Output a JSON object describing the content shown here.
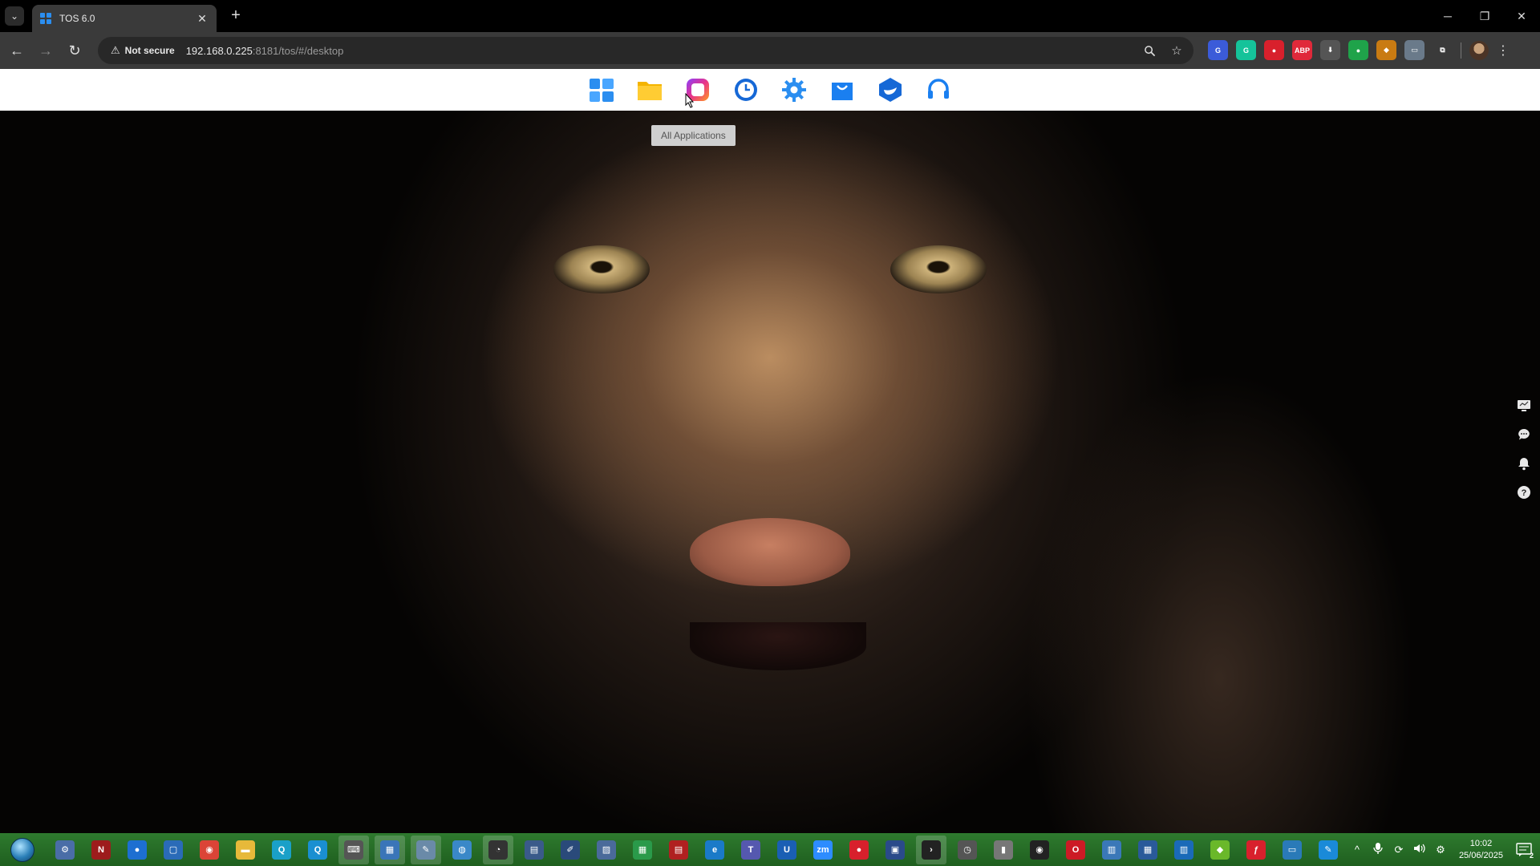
{
  "browser": {
    "tab_title": "TOS 6.0",
    "tab_close_glyph": "✕",
    "new_tab_glyph": "+",
    "window_controls": [
      "─",
      "❐",
      "✕"
    ],
    "nav": {
      "back": "←",
      "forward": "→",
      "reload": "↻"
    },
    "security_label": "Not secure",
    "url_host": "192.168.0.225",
    "url_rest": ":8181/tos/#/desktop",
    "omnibox_icons": [
      "zoom-icon",
      "bookmark-star-icon"
    ],
    "extensions": [
      {
        "name": "translate-extension",
        "color": "#3b5bd9",
        "glyph": "G"
      },
      {
        "name": "grammarly-extension",
        "color": "#15c39a",
        "glyph": "G"
      },
      {
        "name": "red-extension",
        "color": "#d8202c",
        "glyph": "●"
      },
      {
        "name": "adblock-plus-extension",
        "color": "#e0293a",
        "glyph": "ABP"
      },
      {
        "name": "download-extension",
        "color": "#555555",
        "glyph": "⬇"
      },
      {
        "name": "green-extension",
        "color": "#1fa34a",
        "glyph": "●"
      },
      {
        "name": "orange-extension",
        "color": "#c97b12",
        "glyph": "◆"
      },
      {
        "name": "screen-extension",
        "color": "#6a7a8a",
        "glyph": "▭"
      },
      {
        "name": "puzzle-extensions-menu",
        "color": "#3a3a3a",
        "glyph": "⧉"
      }
    ]
  },
  "tos": {
    "dock": [
      {
        "name": "desktop-app-icon",
        "label": "Desktop"
      },
      {
        "name": "file-manager-icon",
        "label": "File Manager"
      },
      {
        "name": "all-applications-icon",
        "label": "All Applications"
      },
      {
        "name": "backup-clock-icon",
        "label": "Backup"
      },
      {
        "name": "control-panel-gear-icon",
        "label": "Control Panel"
      },
      {
        "name": "app-center-bag-icon",
        "label": "App Center"
      },
      {
        "name": "docker-icon",
        "label": "Docker"
      },
      {
        "name": "support-headset-icon",
        "label": "Support"
      }
    ],
    "tooltip": "All Applications",
    "right_rail": [
      "monitor-icon",
      "chat-icon",
      "notification-bell-icon",
      "help-icon"
    ]
  },
  "taskbar": {
    "apps": [
      {
        "name": "settings-gear-app",
        "color": "#4a6da7",
        "glyph": "⚙"
      },
      {
        "name": "red-shield-app",
        "color": "#9d1c1c",
        "glyph": "N"
      },
      {
        "name": "blue-orb-app",
        "color": "#1d6fd1",
        "glyph": "●"
      },
      {
        "name": "window-app",
        "color": "#2a6bb8",
        "glyph": "▢"
      },
      {
        "name": "chrome-app",
        "color": "#db4437",
        "glyph": "◉"
      },
      {
        "name": "file-explorer-app",
        "color": "#e7b93a",
        "glyph": "▬"
      },
      {
        "name": "search-globe-app",
        "color": "#1aa0c8",
        "glyph": "Q"
      },
      {
        "name": "find-app",
        "color": "#1a8fd1",
        "glyph": "Q"
      },
      {
        "name": "keyboard-app",
        "color": "#555555",
        "glyph": "⌨"
      },
      {
        "name": "network-app",
        "color": "#3a75b8",
        "glyph": "▦"
      },
      {
        "name": "tools-app",
        "color": "#6a8aa8",
        "glyph": "✎"
      },
      {
        "name": "globe-app",
        "color": "#3a88c8",
        "glyph": "◍"
      },
      {
        "name": "speed-app",
        "color": "#333333",
        "glyph": "◔"
      },
      {
        "name": "doc-app",
        "color": "#3a5a8a",
        "glyph": "▤"
      },
      {
        "name": "edit-app",
        "color": "#2a4a7a",
        "glyph": "✐"
      },
      {
        "name": "image-app",
        "color": "#4a6a9a",
        "glyph": "▨"
      },
      {
        "name": "sheet-app",
        "color": "#2a9a4a",
        "glyph": "▦"
      },
      {
        "name": "red-doc-app",
        "color": "#b02020",
        "glyph": "▤"
      },
      {
        "name": "edge-app",
        "color": "#1a7ac8",
        "glyph": "e"
      },
      {
        "name": "teams-app",
        "color": "#5558af",
        "glyph": "T"
      },
      {
        "name": "u-app",
        "color": "#1a5fb4",
        "glyph": "U"
      },
      {
        "name": "zoom-app",
        "color": "#2d8cff",
        "glyph": "zm"
      },
      {
        "name": "record-app",
        "color": "#d8202c",
        "glyph": "●"
      },
      {
        "name": "remote-app",
        "color": "#2a4a8a",
        "glyph": "▣"
      },
      {
        "name": "terminal-app",
        "color": "#222222",
        "glyph": "›"
      },
      {
        "name": "clock-app",
        "color": "#555555",
        "glyph": "◷"
      },
      {
        "name": "mic-app",
        "color": "#777777",
        "glyph": "▮"
      },
      {
        "name": "obs-app",
        "color": "#222222",
        "glyph": "◉"
      },
      {
        "name": "opera-app",
        "color": "#cc1b25",
        "glyph": "O"
      },
      {
        "name": "chart-app",
        "color": "#3a78b8",
        "glyph": "▥"
      },
      {
        "name": "calc-app",
        "color": "#2a5a9a",
        "glyph": "▦"
      },
      {
        "name": "bars-app",
        "color": "#1a6ab8",
        "glyph": "▥"
      },
      {
        "name": "cube-app",
        "color": "#6ab82a",
        "glyph": "◆"
      },
      {
        "name": "pdf-app",
        "color": "#d8202c",
        "glyph": "ƒ"
      },
      {
        "name": "monitor-app",
        "color": "#2a7ab8",
        "glyph": "▭"
      },
      {
        "name": "paint-app",
        "color": "#1a8ad8",
        "glyph": "✎"
      }
    ],
    "tray_icons": [
      "^",
      "🎤",
      "⟳",
      "🔊",
      "⚙"
    ],
    "time": "10:02",
    "date": "25/06/2025",
    "notifications_count": "2"
  }
}
